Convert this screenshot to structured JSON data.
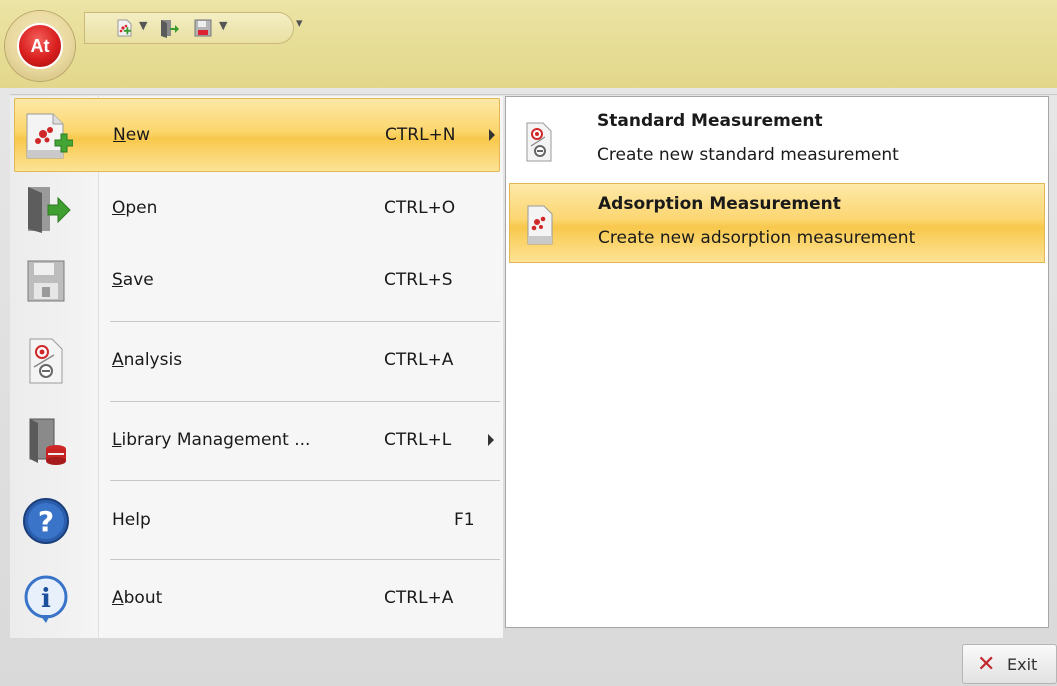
{
  "app": {
    "orb_label": "At",
    "colors": {
      "highlight": "#f8c84c",
      "titlebar": "#e6dc94",
      "orb_red": "#d81e1e",
      "exit_red": "#c0272d"
    }
  },
  "quick_access": [
    {
      "icon": "new-measurement-icon",
      "has_dropdown": true
    },
    {
      "icon": "open-door-icon",
      "has_dropdown": false
    },
    {
      "icon": "save-disk-icon",
      "has_dropdown": true
    }
  ],
  "menu": {
    "items": [
      {
        "label": "New",
        "shortcut": "CTRL+N",
        "icon": "new-measurement-icon",
        "submenu": true,
        "highlighted": true
      },
      {
        "label": "Open",
        "shortcut": "CTRL+O",
        "icon": "open-door-icon",
        "submenu": false
      },
      {
        "label": "Save",
        "shortcut": "CTRL+S",
        "icon": "save-disk-icon",
        "submenu": false
      },
      {
        "label": "Analysis",
        "shortcut": "CTRL+A",
        "icon": "analysis-document-icon",
        "submenu": false
      },
      {
        "label": "Library Management ...",
        "shortcut": "CTRL+L",
        "icon": "library-database-icon",
        "submenu": true
      },
      {
        "label": "Help",
        "shortcut": "F1",
        "icon": "help-icon",
        "submenu": false
      },
      {
        "label": "About",
        "shortcut": "CTRL+A",
        "icon": "info-icon",
        "submenu": false
      }
    ]
  },
  "submenu": {
    "items": [
      {
        "title": "Standard Measurement",
        "description": "Create new standard measurement",
        "icon": "standard-measurement-icon"
      },
      {
        "title": "Adsorption Measurement",
        "description": "Create new adsorption measurement",
        "icon": "adsorption-measurement-icon",
        "highlighted": true
      }
    ]
  },
  "footer": {
    "exit_label": "Exit"
  }
}
